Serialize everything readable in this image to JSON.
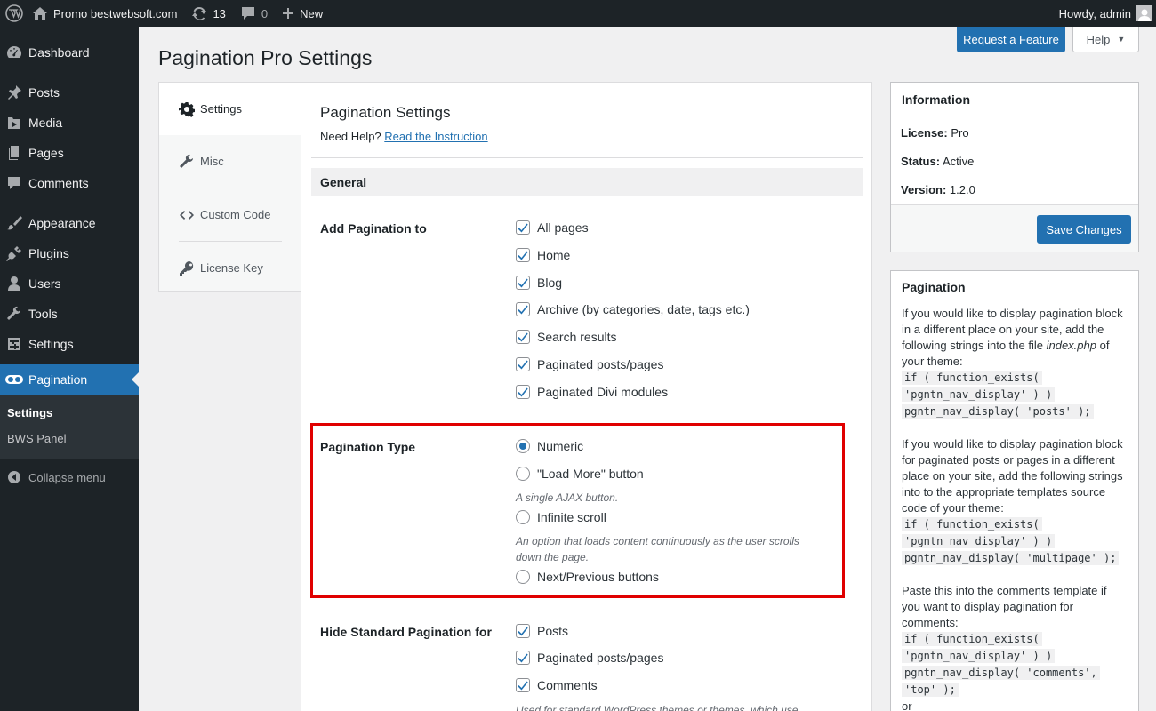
{
  "adminbar": {
    "site_name": "Promo bestwebsoft.com",
    "updates_count": "13",
    "comments_count": "0",
    "new_label": "New",
    "greeting": "Howdy, admin"
  },
  "sidebar": {
    "items": [
      {
        "label": "Dashboard",
        "icon": "dashboard-icon"
      },
      {
        "label": "Posts",
        "icon": "pin-icon"
      },
      {
        "label": "Media",
        "icon": "media-icon"
      },
      {
        "label": "Pages",
        "icon": "pages-icon"
      },
      {
        "label": "Comments",
        "icon": "comments-icon"
      },
      {
        "label": "Appearance",
        "icon": "brush-icon"
      },
      {
        "label": "Plugins",
        "icon": "plug-icon"
      },
      {
        "label": "Users",
        "icon": "users-icon"
      },
      {
        "label": "Tools",
        "icon": "wrench-icon"
      },
      {
        "label": "Settings",
        "icon": "settings-icon"
      }
    ],
    "current": {
      "label": "Pagination",
      "icon": "toggle-icon"
    },
    "submenu": [
      "Settings",
      "BWS Panel"
    ],
    "collapse_label": "Collapse menu"
  },
  "header": {
    "request_feature": "Request a Feature",
    "help": "Help",
    "page_title": "Pagination Pro Settings"
  },
  "tabs": [
    {
      "label": "Settings",
      "icon": "gear-icon"
    },
    {
      "label": "Misc",
      "icon": "wrench-icon"
    },
    {
      "label": "Custom Code",
      "icon": "code-icon"
    },
    {
      "label": "License Key",
      "icon": "key-icon"
    }
  ],
  "main": {
    "title": "Pagination Settings",
    "help_prefix": "Need Help?",
    "help_link": "Read the Instruction",
    "section_general": "General",
    "add_pagination_label": "Add Pagination to",
    "add_pagination_options": [
      {
        "label": "All pages",
        "checked": true
      },
      {
        "label": "Home",
        "checked": true
      },
      {
        "label": "Blog",
        "checked": true
      },
      {
        "label": "Archive (by categories, date, tags etc.)",
        "checked": true
      },
      {
        "label": "Search results",
        "checked": true
      },
      {
        "label": "Paginated posts/pages",
        "checked": true
      },
      {
        "label": "Paginated Divi modules",
        "checked": true
      }
    ],
    "pagination_type_label": "Pagination Type",
    "pagination_type_options": [
      {
        "label": "Numeric",
        "selected": true
      },
      {
        "label": "\"Load More\" button",
        "selected": false,
        "desc": "A single AJAX button."
      },
      {
        "label": "Infinite scroll",
        "selected": false,
        "desc": "An option that loads content continuously as the user scrolls down the page."
      },
      {
        "label": "Next/Previous buttons",
        "selected": false
      }
    ],
    "hide_label": "Hide Standard Pagination for",
    "hide_options": [
      {
        "label": "Posts",
        "checked": true
      },
      {
        "label": "Paginated posts/pages",
        "checked": true
      },
      {
        "label": "Comments",
        "checked": true
      }
    ],
    "hide_desc": "Used for standard WordPress themes or themes, which use"
  },
  "info_box": {
    "title": "Information",
    "license_label": "License:",
    "license_value": "Pro",
    "status_label": "Status:",
    "status_value": "Active",
    "version_label": "Version:",
    "version_value": "1.2.0",
    "save_label": "Save Changes"
  },
  "pagination_box": {
    "title": "Pagination",
    "p1_a": "If you would like to display pagination block in a different place on your site, add the following strings into the file ",
    "p1_file": "index.php",
    "p1_b": " of your theme:",
    "code1_a": "if ( function_exists(",
    "code1_b": "'pgntn_nav_display' ) )",
    "code1_c": "pgntn_nav_display( 'posts' );",
    "p2": "If you would like to display pagination block for paginated posts or pages in a different place on your site, add the following strings into to the appropriate templates source code of your theme:",
    "code2_a": "if ( function_exists(",
    "code2_b": "'pgntn_nav_display' ) )",
    "code2_c": "pgntn_nav_display( 'multipage' );",
    "p3": "Paste this into the comments template if you want to display pagination for comments:",
    "code3_a": "if ( function_exists(",
    "code3_b": "'pgntn_nav_display' ) )",
    "code3_c": "pgntn_nav_display( 'comments',",
    "code3_d": "'top' );",
    "p4": "or"
  }
}
